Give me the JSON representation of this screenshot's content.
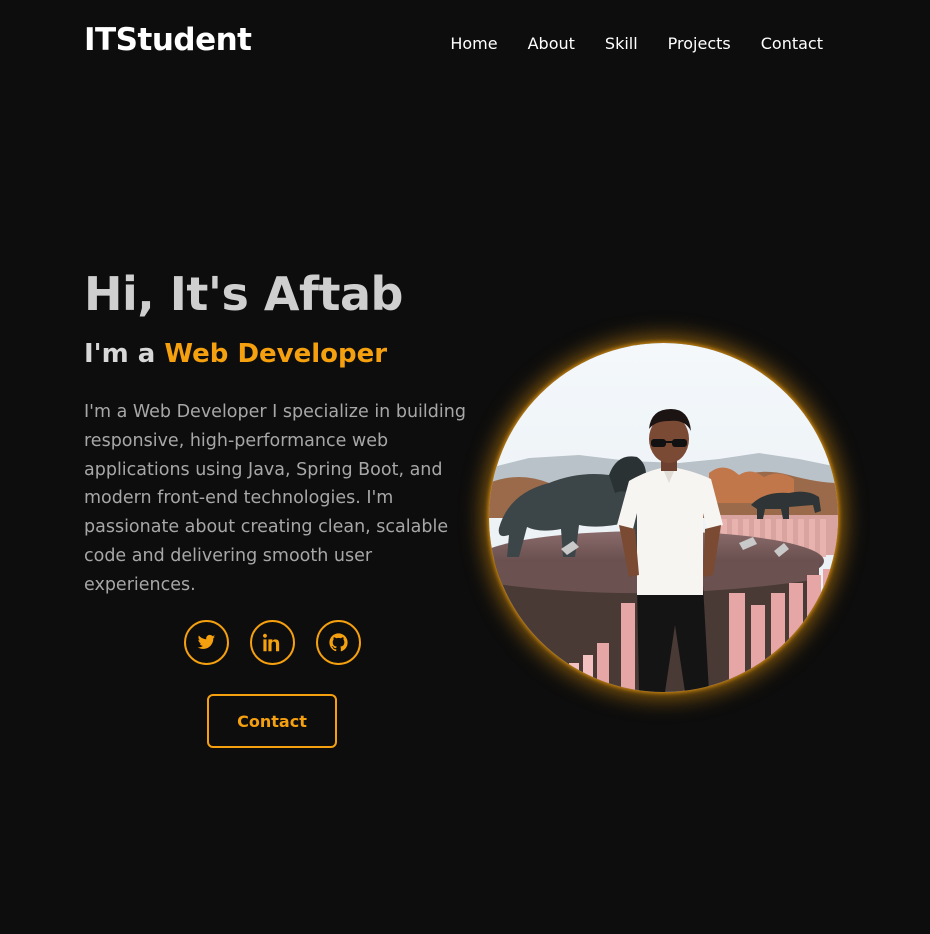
{
  "header": {
    "logo": "ITStudent",
    "nav": [
      "Home",
      "About",
      "Skill",
      "Projects",
      "Contact"
    ]
  },
  "hero": {
    "greeting": "Hi, It's Aftab",
    "role_prefix": "I'm a",
    "role": "Web Developer",
    "description": "I'm a Web Developer I specialize in building responsive, high-performance web applications using Java, Spring Boot, and modern front-end technologies. I'm passionate about creating clean, scalable code and delivering smooth user experiences.",
    "socials": [
      "twitter-icon",
      "linkedin-icon",
      "github-icon"
    ],
    "contact_button": "Contact"
  },
  "colors": {
    "background": "#0d0d0d",
    "accent": "#f5a00f",
    "text": "#ffffff",
    "muted": "#a7a7a7"
  }
}
